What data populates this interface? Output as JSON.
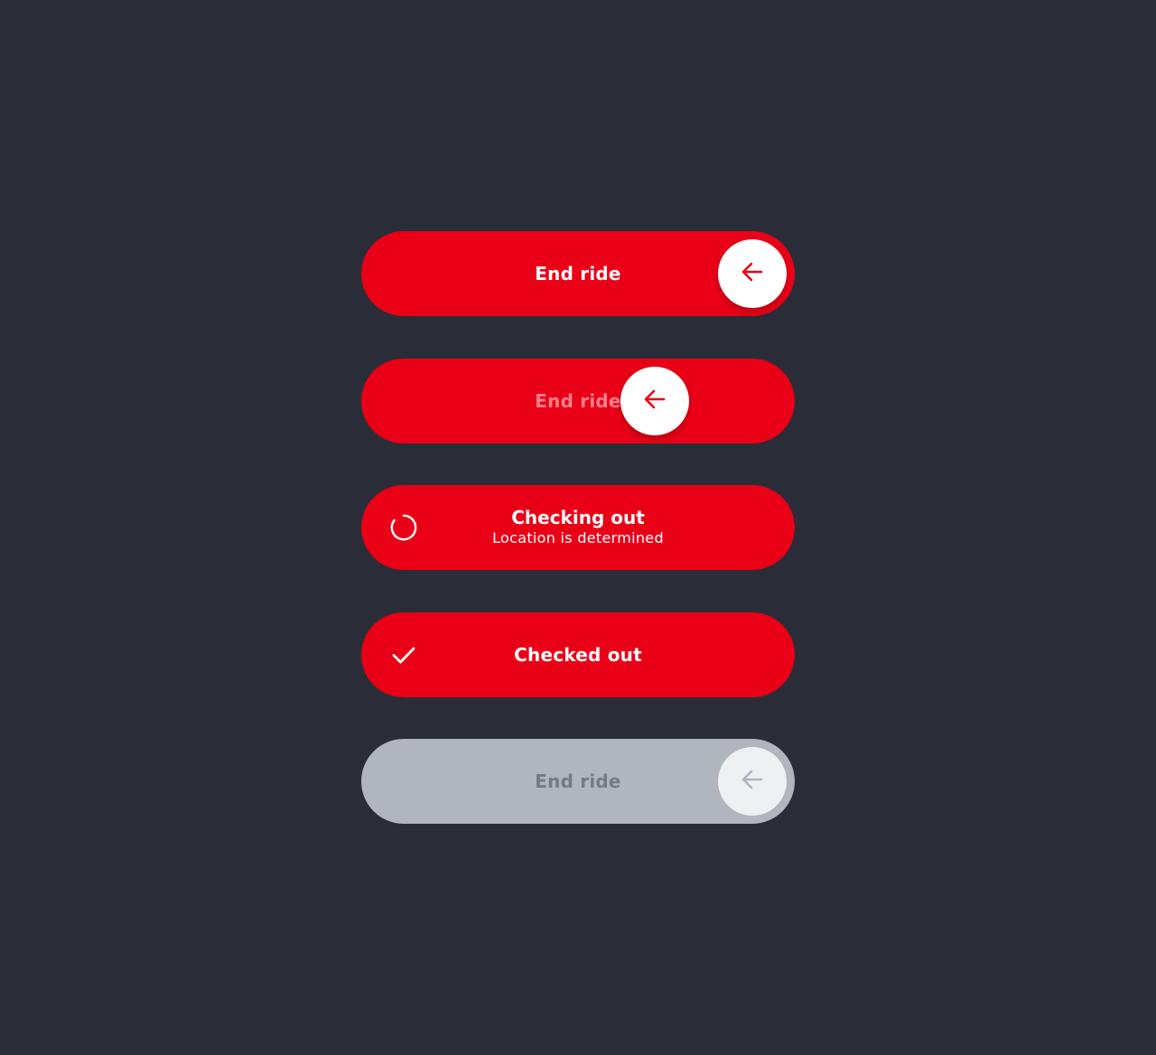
{
  "sliders": {
    "idle": {
      "label": "End ride",
      "knob_icon": "arrow-left-icon"
    },
    "dragging": {
      "label": "End ride",
      "knob_icon": "arrow-left-icon"
    },
    "checking_out": {
      "title": "Checking out",
      "subtitle": "Location is determined",
      "status_icon": "spinner-icon"
    },
    "checked_out": {
      "title": "Checked out",
      "status_icon": "checkmark-icon"
    },
    "disabled": {
      "label": "End ride",
      "knob_icon": "arrow-left-icon"
    }
  },
  "colors": {
    "background": "#2a2d38",
    "accent_red": "#ea0016",
    "disabled_track": "#b1b5bd",
    "disabled_text": "#757a86",
    "knob": "#ffffff"
  }
}
